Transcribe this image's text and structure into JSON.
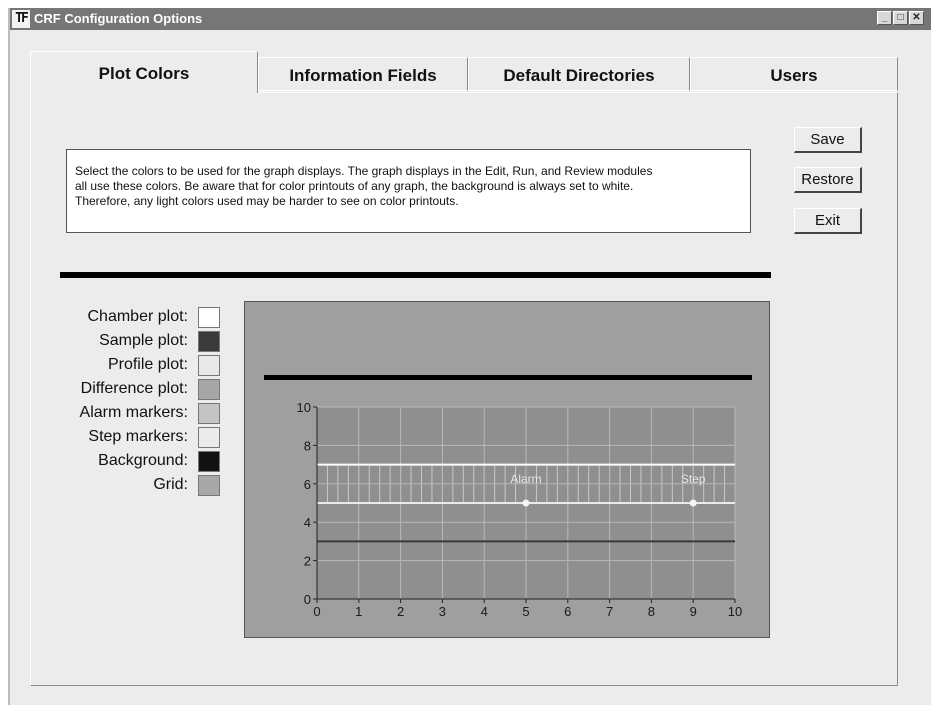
{
  "window": {
    "title": "CRF Configuration Options",
    "icon_text": "TF",
    "controls": {
      "minimize": "_",
      "maximize": "□",
      "close": "✕"
    }
  },
  "tabs": [
    {
      "label": "Plot Colors",
      "active": true
    },
    {
      "label": "Information Fields",
      "active": false
    },
    {
      "label": "Default Directories",
      "active": false
    },
    {
      "label": "Users",
      "active": false
    }
  ],
  "info": {
    "lines": [
      "Select the colors to be used for the graph displays.  The graph displays in the Edit, Run, and Review modules",
      "all use these colors.  Be aware that for color printouts of any graph, the background is always set to white.",
      "Therefore, any light colors used may be harder to see on color printouts."
    ]
  },
  "buttons": {
    "save": "Save",
    "restore": "Restore",
    "exit": "Exit"
  },
  "color_settings": [
    {
      "label": "Chamber plot:",
      "color": "#ffffff"
    },
    {
      "label": "Sample plot:",
      "color": "#3a3a3a"
    },
    {
      "label": "Profile plot:",
      "color": "#e9e9e9"
    },
    {
      "label": "Difference plot:",
      "color": "#a6a6a6"
    },
    {
      "label": "Alarm markers:",
      "color": "#c4c4c4"
    },
    {
      "label": "Step markers:",
      "color": "#ebebeb"
    },
    {
      "label": "Background:",
      "color": "#111111"
    },
    {
      "label": "Grid:",
      "color": "#a8a8a8"
    }
  ],
  "preview": {
    "x_ticks": [
      "0",
      "1",
      "2",
      "3",
      "4",
      "5",
      "6",
      "7",
      "8",
      "9",
      "10"
    ],
    "y_ticks": [
      "0",
      "2",
      "4",
      "6",
      "8",
      "10"
    ],
    "alarm_label": "Alarm",
    "step_label": "Step",
    "plot_bg": "#8f8f8f",
    "grid_color": "#b8b8b8"
  },
  "chart_data": {
    "type": "line",
    "x_range": [
      0,
      10
    ],
    "y_range": [
      0,
      10
    ],
    "grid": true,
    "x_ticks": [
      0,
      1,
      2,
      3,
      4,
      5,
      6,
      7,
      8,
      9,
      10
    ],
    "y_ticks": [
      0,
      2,
      4,
      6,
      8,
      10
    ],
    "series": [
      {
        "values_x": [
          0,
          10
        ],
        "values_y": [
          7,
          7
        ],
        "color": "#ffffff"
      },
      {
        "values_x": [
          0,
          10
        ],
        "values_y": [
          5,
          5
        ],
        "color": "#ebebeb"
      },
      {
        "values_x": [
          0,
          10
        ],
        "values_y": [
          3,
          3
        ],
        "color": "#3a3a3a"
      }
    ],
    "markers": [
      {
        "label": "Alarm",
        "x": 5,
        "y": 5
      },
      {
        "label": "Step",
        "x": 9,
        "y": 5
      }
    ]
  }
}
